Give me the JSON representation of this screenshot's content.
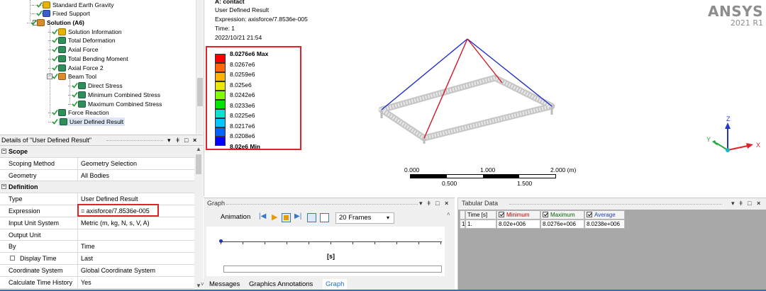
{
  "tree": {
    "items": [
      {
        "label": "Standard Earth Gravity",
        "icon": "gravity-icon",
        "color": "#e6b400"
      },
      {
        "label": "Fixed Support",
        "icon": "fixed-support-icon",
        "color": "#3a5fcd"
      },
      {
        "label": "Solution (A6)",
        "icon": "solution-icon",
        "color": "#d88c2a"
      },
      {
        "label": "Solution Information",
        "icon": "solution-information-icon",
        "color": "#e6b400"
      },
      {
        "label": "Total Deformation",
        "icon": "result-icon",
        "color": "#2f8f5b"
      },
      {
        "label": "Axial Force",
        "icon": "result-icon",
        "color": "#2f8f5b"
      },
      {
        "label": "Total Bending Moment",
        "icon": "result-icon",
        "color": "#2f8f5b"
      },
      {
        "label": "Axial Force 2",
        "icon": "result-icon",
        "color": "#2f8f5b"
      },
      {
        "label": "Beam Tool",
        "icon": "beam-tool-icon",
        "color": "#d88c2a"
      },
      {
        "label": "Direct Stress",
        "icon": "result-icon",
        "color": "#2f8f5b"
      },
      {
        "label": "Minimum Combined Stress",
        "icon": "result-icon",
        "color": "#2f8f5b"
      },
      {
        "label": "Maximum Combined Stress",
        "icon": "result-icon",
        "color": "#2f8f5b"
      },
      {
        "label": "Force Reaction",
        "icon": "force-reaction-icon",
        "color": "#2f8f5b"
      },
      {
        "label": "User Defined Result",
        "icon": "user-defined-result-icon",
        "color": "#2f8f5b"
      }
    ]
  },
  "details": {
    "title": "Details of \"User Defined Result\"",
    "pin": "⬍",
    "sections": [
      {
        "name": "Scope",
        "rows": [
          {
            "key": "Scoping Method",
            "value": "Geometry Selection"
          },
          {
            "key": "Geometry",
            "value": "All Bodies"
          }
        ]
      },
      {
        "name": "Definition",
        "rows": [
          {
            "key": "Type",
            "value": "User Defined Result"
          },
          {
            "key": "Expression",
            "value": "= axisforce/7.8536e-005"
          },
          {
            "key": "Input Unit System",
            "value": "Metric (m, kg, N, s, V, A)"
          },
          {
            "key": "Output Unit",
            "value": ""
          },
          {
            "key": "By",
            "value": "Time"
          },
          {
            "key": "Display Time",
            "value": "Last"
          },
          {
            "key": "Coordinate System",
            "value": "Global Coordinate System"
          },
          {
            "key": "Calculate Time History",
            "value": "Yes"
          }
        ]
      }
    ]
  },
  "viewport": {
    "header": [
      "A: contact",
      "User Defined Result",
      "Expression: axisforce/7.8536e-005",
      "Time: 1",
      "2022/10/21 21:54"
    ],
    "brand": "ANSYS",
    "version": "2021 R1",
    "legend": {
      "labels": [
        "8.0276e6 Max",
        "8.0267e6",
        "8.0259e6",
        "8.025e6",
        "8.0242e6",
        "8.0233e6",
        "8.0225e6",
        "8.0217e6",
        "8.0208e6",
        "8.02e6 Min"
      ],
      "colors": [
        "#ff0000",
        "#ff6a00",
        "#ffb200",
        "#e8e800",
        "#7fff00",
        "#00e600",
        "#00e6c8",
        "#00c8ff",
        "#0064ff",
        "#0000ff"
      ]
    },
    "scale": {
      "top": [
        "0.000",
        "1.000",
        "2.000 (m)"
      ],
      "bottom": [
        "0.500",
        "1.500"
      ]
    },
    "triad": {
      "x": "X",
      "y": "Y",
      "z": "Z",
      "x_color": "#e0222a",
      "y_color": "#1fa83a",
      "z_color": "#2437c8"
    }
  },
  "graph": {
    "title": "Graph",
    "animation_label": "Animation",
    "frames": "20 Frames",
    "axis_unit": "[s]",
    "tabs": [
      "Messages",
      "Graphics Annotations",
      "Graph"
    ]
  },
  "tabular": {
    "title": "Tabular Data",
    "headers": [
      "Time [s]",
      "Minimum",
      "Maximum",
      "Average"
    ],
    "header_colors": [
      "#000000",
      "#c00000",
      "#006400",
      "#1f3fbf"
    ],
    "rows": [
      {
        "index": "1",
        "time": "1.",
        "min": "8.02e+006",
        "max": "8.0276e+006",
        "avg": "8.0238e+006"
      }
    ]
  }
}
